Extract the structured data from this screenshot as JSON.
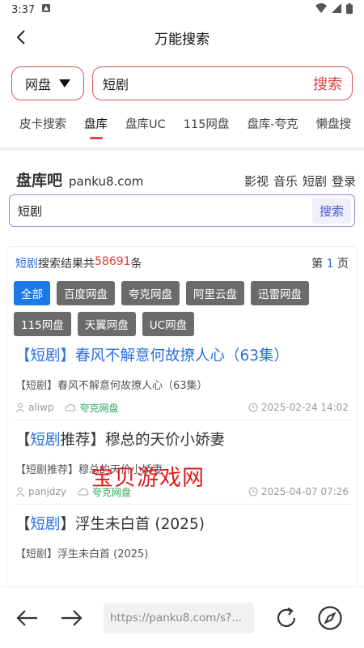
{
  "status_bar": {
    "time": "3:37"
  },
  "app_bar": {
    "title": "万能搜索"
  },
  "search": {
    "drive_selected": "网盘",
    "keyword": "短剧",
    "search_label": "搜索"
  },
  "tabs": [
    {
      "label": "皮卡搜索",
      "active": false
    },
    {
      "label": "盘库",
      "active": true
    },
    {
      "label": "盘库UC",
      "active": false
    },
    {
      "label": "115网盘",
      "active": false
    },
    {
      "label": "盘库-夸克",
      "active": false
    },
    {
      "label": "懒盘搜",
      "active": false
    }
  ],
  "site": {
    "name": "盘库吧",
    "domain": "panku8.com",
    "nav": [
      "影视",
      "音乐",
      "短剧",
      "登录"
    ],
    "query": "短剧",
    "search_button": "搜索",
    "summary": {
      "keyword": "短剧",
      "text_before": "搜索结果共",
      "count": "58691",
      "text_after": "条",
      "page_prefix": "第",
      "page_num": "1",
      "page_suffix": "页"
    },
    "filters": [
      "全部",
      "百度网盘",
      "夸克网盘",
      "阿里云盘",
      "迅雷网盘",
      "115网盘",
      "天翼网盘",
      "UC网盘"
    ],
    "results": [
      {
        "title": "【短剧】春风不解意何故撩人心（63集）",
        "desc": "【短剧】春风不解意何故撩人心（63集）",
        "user": "aliwp",
        "disk": "夸克网盘",
        "date": "2025-02-24 14:02"
      },
      {
        "title_pre": "【",
        "title_kw": "短剧",
        "title_post": "推荐】穆总的天价小娇妻",
        "desc": "【短剧推荐】穆总的天价小娇妻",
        "user": "panjdzy",
        "disk": "夸克网盘",
        "date": "2025-04-07 07:26"
      },
      {
        "title_pre": "【",
        "title_kw": "短剧",
        "title_post": "】浮生未白首 (2025)",
        "desc": "【短剧】浮生未白首 (2025)",
        "user": "",
        "disk": "",
        "date": ""
      }
    ]
  },
  "watermark": "宝贝游戏网",
  "browser": {
    "url": "https://panku8.com/s?..."
  },
  "colors": {
    "accent_red": "#e04545",
    "link_blue": "#2a6fe0",
    "chip_active": "#1e78e6",
    "chip": "#6b6b6b",
    "disk_green": "#2aa55a"
  }
}
